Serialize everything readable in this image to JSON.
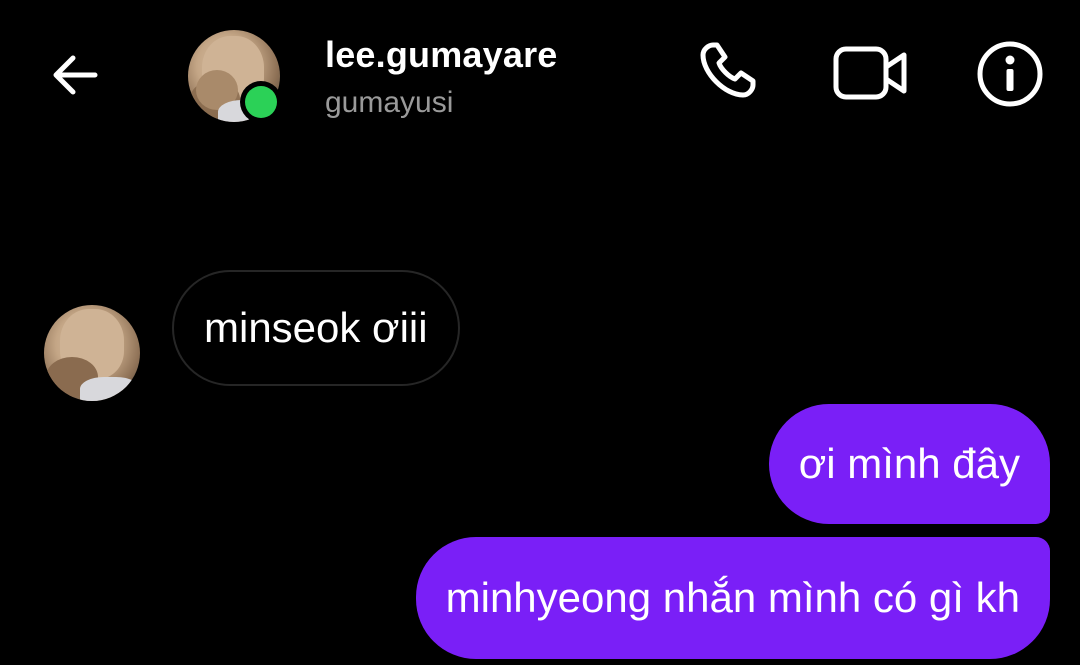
{
  "header": {
    "username": "lee.gumayare",
    "handle": "gumayusi",
    "online_color": "#2bd157",
    "icons": {
      "back": "back-arrow-icon",
      "call": "phone-icon",
      "video": "video-camera-icon",
      "info": "info-icon"
    }
  },
  "messages": [
    {
      "direction": "incoming",
      "text": "minseok ơiii"
    },
    {
      "direction": "outgoing",
      "text": "ơi mình đây"
    },
    {
      "direction": "outgoing",
      "text": "minhyeong nhắn mình có gì kh"
    }
  ],
  "colors": {
    "background": "#000000",
    "outgoing_bubble": "#7a1ff7",
    "incoming_border": "#262626",
    "secondary_text": "#9a9a9a"
  }
}
